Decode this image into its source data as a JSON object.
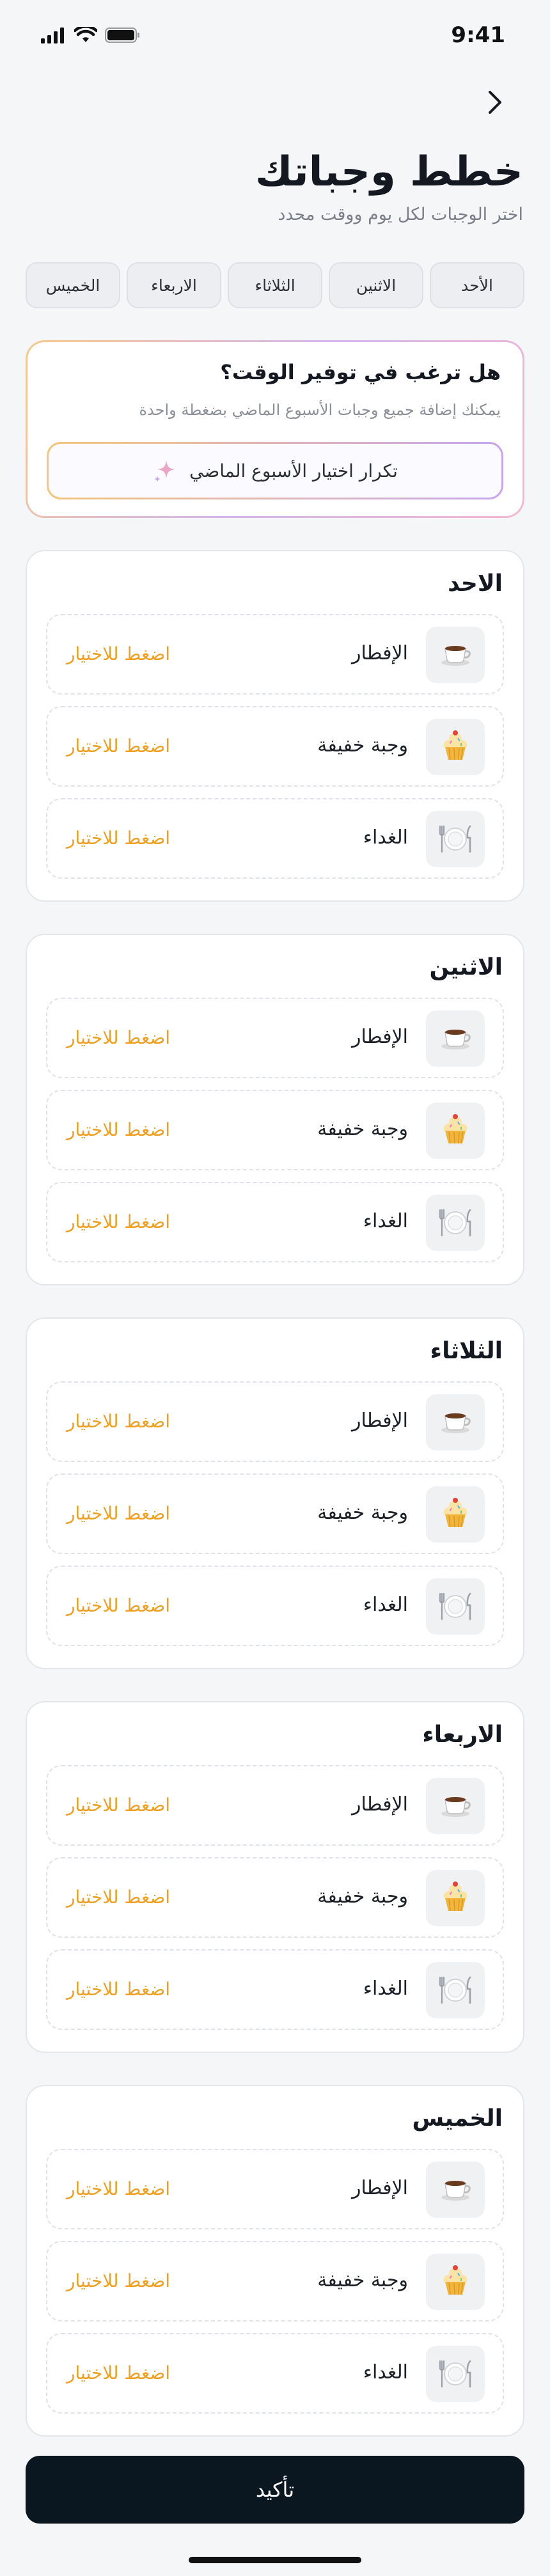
{
  "status_bar": {
    "time": "9:41"
  },
  "header": {
    "title": "خطط وجباتك",
    "subtitle": "اختر الوجبات لكل يوم ووقت محدد"
  },
  "tabs": [
    "الأحد",
    "الاثنين",
    "الثلاثاء",
    "الاربعاء",
    "الخميس"
  ],
  "promo": {
    "title": "هل ترغب في توفير الوقت؟",
    "text": "يمكنك إضافة جميع وجبات الأسبوع الماضي بضغطة واحدة",
    "button_label": "تكرار اختيار الأسبوع الماضي"
  },
  "days": [
    {
      "name": "الاحد",
      "meals": [
        {
          "label": "الإفطار",
          "icon": "coffee-icon",
          "action": "اضغط للاختيار"
        },
        {
          "label": "وجبة خفيفة",
          "icon": "cupcake-icon",
          "action": "اضغط للاختيار"
        },
        {
          "label": "الغداء",
          "icon": "plate-icon",
          "action": "اضغط للاختيار"
        }
      ]
    },
    {
      "name": "الاثنين",
      "meals": [
        {
          "label": "الإفطار",
          "icon": "coffee-icon",
          "action": "اضغط للاختيار"
        },
        {
          "label": "وجبة خفيفة",
          "icon": "cupcake-icon",
          "action": "اضغط للاختيار"
        },
        {
          "label": "الغداء",
          "icon": "plate-icon",
          "action": "اضغط للاختيار"
        }
      ]
    },
    {
      "name": "الثلاثاء",
      "meals": [
        {
          "label": "الإفطار",
          "icon": "coffee-icon",
          "action": "اضغط للاختيار"
        },
        {
          "label": "وجبة خفيفة",
          "icon": "cupcake-icon",
          "action": "اضغط للاختيار"
        },
        {
          "label": "الغداء",
          "icon": "plate-icon",
          "action": "اضغط للاختيار"
        }
      ]
    },
    {
      "name": "الاربعاء",
      "meals": [
        {
          "label": "الإفطار",
          "icon": "coffee-icon",
          "action": "اضغط للاختيار"
        },
        {
          "label": "وجبة خفيفة",
          "icon": "cupcake-icon",
          "action": "اضغط للاختيار"
        },
        {
          "label": "الغداء",
          "icon": "plate-icon",
          "action": "اضغط للاختيار"
        }
      ]
    },
    {
      "name": "الخميس",
      "meals": [
        {
          "label": "الإفطار",
          "icon": "coffee-icon",
          "action": "اضغط للاختيار"
        },
        {
          "label": "وجبة خفيفة",
          "icon": "cupcake-icon",
          "action": "اضغط للاختيار"
        },
        {
          "label": "الغداء",
          "icon": "plate-icon",
          "action": "اضغط للاختيار"
        }
      ]
    }
  ],
  "confirm_label": "تأكيد",
  "colors": {
    "accent": "#f0a020",
    "primary_button": "#0a1620",
    "background": "#f5f6f8"
  }
}
